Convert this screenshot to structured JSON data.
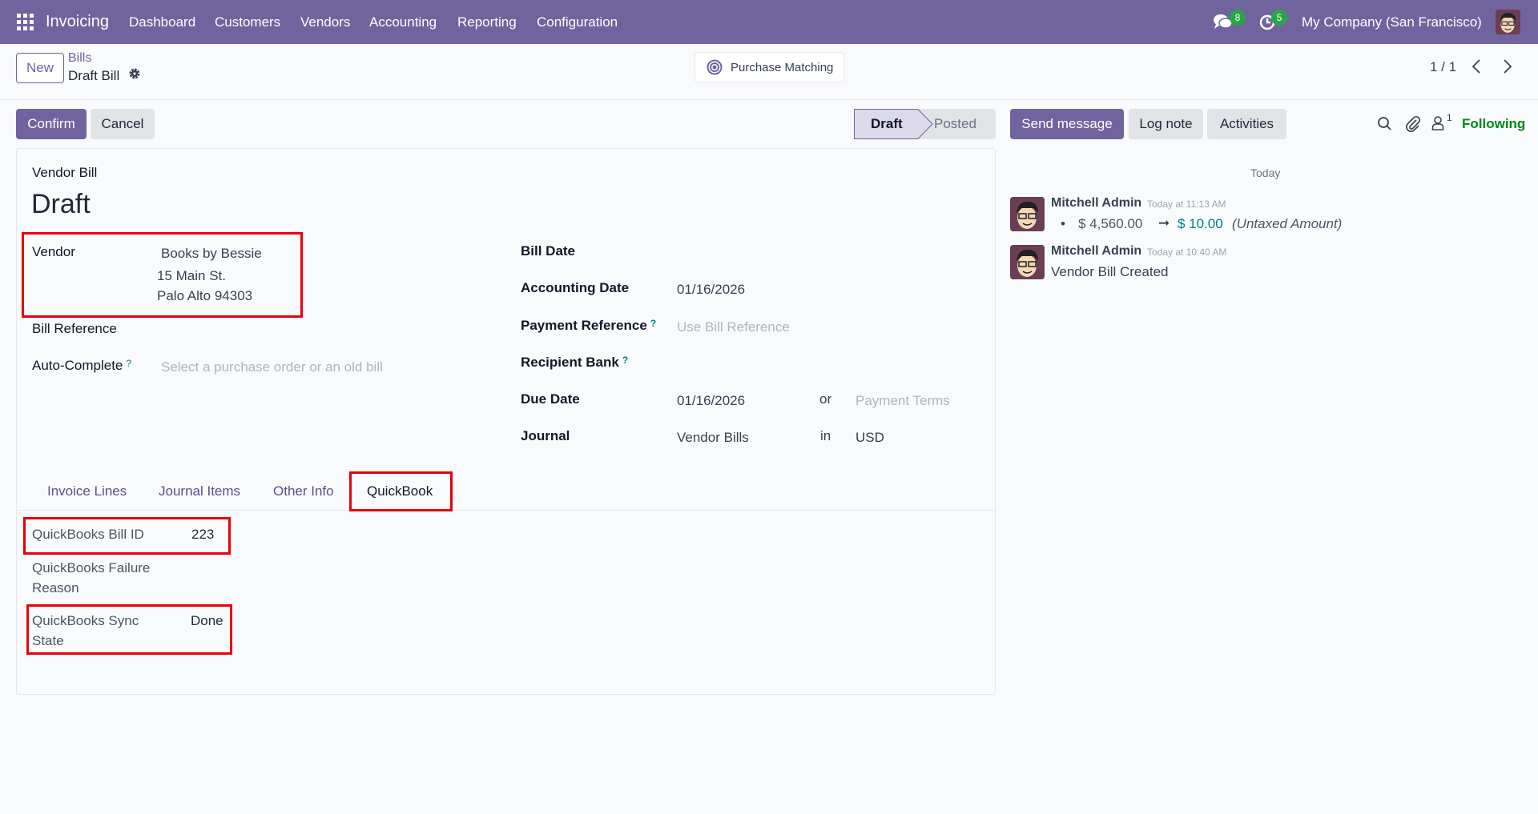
{
  "navbar": {
    "app_name": "Invoicing",
    "menu": [
      "Dashboard",
      "Customers",
      "Vendors",
      "Accounting",
      "Reporting",
      "Configuration"
    ],
    "messages_count": "8",
    "activities_count": "5",
    "company": "My Company (San Francisco)",
    "accent": "#71639e"
  },
  "control_panel": {
    "new_label": "New",
    "breadcrumb_parent": "Bills",
    "breadcrumb_current": "Draft Bill",
    "smart_button": "Purchase Matching",
    "pager": "1 / 1"
  },
  "actions": {
    "confirm": "Confirm",
    "cancel": "Cancel"
  },
  "statusbar": {
    "stages": [
      "Draft",
      "Posted"
    ],
    "active": "Draft"
  },
  "form": {
    "subtitle": "Vendor Bill",
    "title": "Draft",
    "vendor": {
      "label": "Vendor",
      "name": "Books by Bessie",
      "street": "15 Main St.",
      "city": "Palo Alto 94303"
    },
    "bill_reference": {
      "label": "Bill Reference"
    },
    "auto_complete": {
      "label": "Auto-Complete",
      "help": "?",
      "placeholder": "Select a purchase order or an old bill"
    },
    "bill_date": {
      "label": "Bill Date"
    },
    "accounting_date": {
      "label": "Accounting Date",
      "value": "01/16/2026"
    },
    "payment_reference": {
      "label": "Payment Reference",
      "help": "?",
      "placeholder": "Use Bill Reference"
    },
    "recipient_bank": {
      "label": "Recipient Bank",
      "help": "?"
    },
    "due_date": {
      "label": "Due Date",
      "value": "01/16/2026",
      "or": "or",
      "terms_placeholder": "Payment Terms"
    },
    "journal": {
      "label": "Journal",
      "value": "Vendor Bills",
      "in": "in",
      "currency": "USD"
    },
    "tabs": [
      "Invoice Lines",
      "Journal Items",
      "Other Info",
      "QuickBook"
    ],
    "active_tab": "QuickBook",
    "quickbook": {
      "bill_id": {
        "label": "QuickBooks Bill ID",
        "value": "223"
      },
      "failure_reason": {
        "label_1": "QuickBooks Failure",
        "label_2": "Reason"
      },
      "sync_state": {
        "label_1": "QuickBooks Sync",
        "label_2": "State",
        "value": "Done"
      }
    }
  },
  "chatter": {
    "send_message": "Send message",
    "log_note": "Log note",
    "activities": "Activities",
    "followers_count": "1",
    "following": "Following",
    "date_separator": "Today",
    "messages": [
      {
        "author": "Mitchell Admin",
        "time": "Today at 11:13 AM",
        "old_value": "$ 4,560.00",
        "new_value": "$ 10.00",
        "field": "(Untaxed Amount)"
      },
      {
        "author": "Mitchell Admin",
        "time": "Today at 10:40 AM",
        "body": "Vendor Bill Created"
      }
    ]
  }
}
